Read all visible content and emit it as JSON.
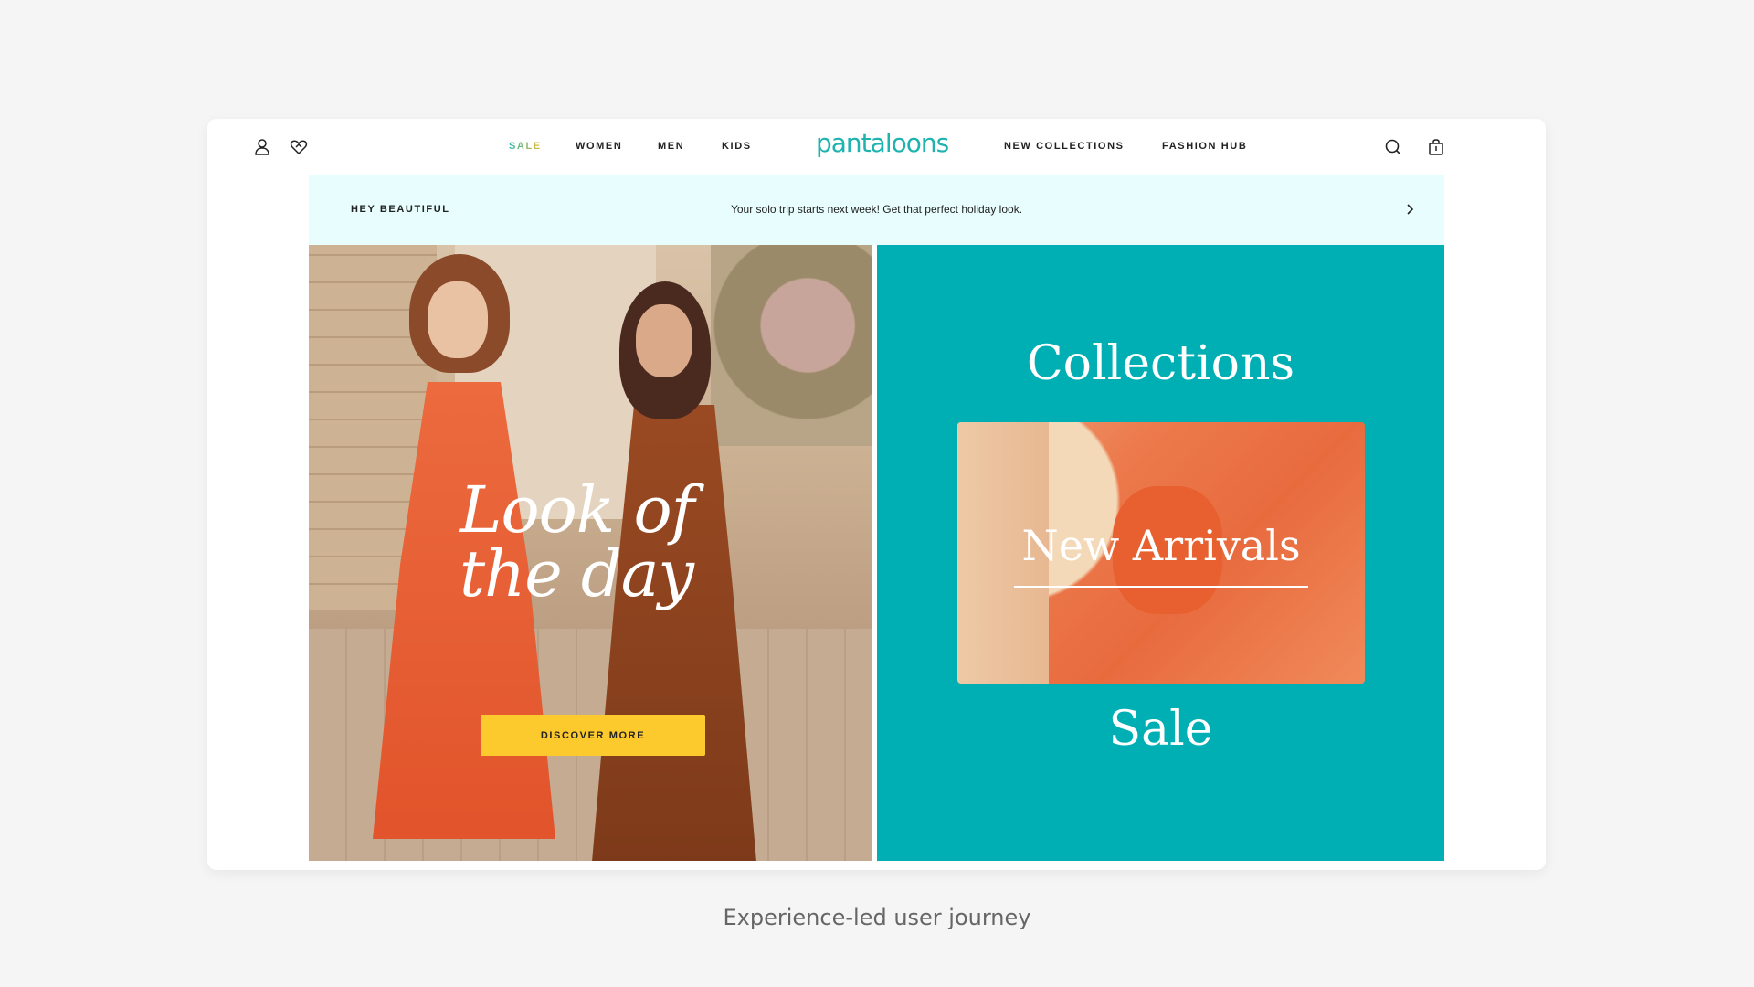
{
  "header": {
    "logo": "pantaloons",
    "nav_left": [
      {
        "label": "SALE",
        "color": "#2fb7b0"
      },
      {
        "label": "WOMEN"
      },
      {
        "label": "MEN"
      },
      {
        "label": "KIDS"
      }
    ],
    "nav_right": [
      {
        "label": "NEW COLLECTIONS"
      },
      {
        "label": "FASHION HUB"
      }
    ],
    "icons": [
      "user-icon",
      "wishlist-heart-icon",
      "search-icon",
      "shopping-bag-icon"
    ]
  },
  "announcement": {
    "label": "HEY BEAUTIFUL",
    "message": "Your solo trip starts next week! Get that perfect holiday look.",
    "icon": "chevron-right-icon",
    "background": "#e8fdfd"
  },
  "hero": {
    "headline_line1": "Look of",
    "headline_line2": "the day",
    "cta_label": "DISCOVER MORE",
    "cta_color": "#fdca2e"
  },
  "side_panel": {
    "background": "#00afb4",
    "collections_title": "Collections",
    "new_arrivals_label": "New Arrivals",
    "sale_label": "Sale"
  },
  "caption": "Experience-led user journey",
  "colors": {
    "brand_teal": "#1fb3b0",
    "page_background": "#f5f5f5"
  }
}
